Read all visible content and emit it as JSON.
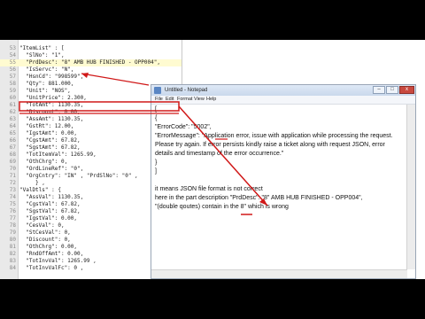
{
  "editor": {
    "lines": [
      {
        "n": "53",
        "text": "\"ItemList\" : ["
      },
      {
        "n": "54",
        "text": "  \"SlNo\": \"1\","
      },
      {
        "n": "55",
        "text": "  \"PrdDesc\": \"8\" AMB HUB FINISHED - OPP004\","
      },
      {
        "n": "56",
        "text": "  \"IsServc\": \"N\","
      },
      {
        "n": "57",
        "text": "  \"HsnCd\": \"998599\","
      },
      {
        "n": "58",
        "text": "  \"Qty\": 881.000,"
      },
      {
        "n": "59",
        "text": "  \"Unit\": \"NOS\","
      },
      {
        "n": "60",
        "text": "  \"UnitPrice\": 2.300,"
      },
      {
        "n": "61",
        "text": "  \"TotAmt\": 1130.35,"
      },
      {
        "n": "62",
        "text": "  \"Discount\": 0.00,"
      },
      {
        "n": "63",
        "text": "  \"AssAmt\": 1130.35,"
      },
      {
        "n": "64",
        "text": "  \"GstRt\": 12.00,"
      },
      {
        "n": "65",
        "text": "  \"IgstAmt\": 0.00,"
      },
      {
        "n": "66",
        "text": "  \"CgstAmt\": 67.82,"
      },
      {
        "n": "67",
        "text": "  \"SgstAmt\": 67.82,"
      },
      {
        "n": "68",
        "text": "  \"TotItemVal\": 1265.99,"
      },
      {
        "n": "69",
        "text": "  \"OthChrg\": 0,"
      },
      {
        "n": "70",
        "text": "  \"OrdLineRef\": \"0\","
      },
      {
        "n": "71",
        "text": "  \"OrgCntry\": \"IN\" , \"PrdSlNo\": \"0\" ,"
      },
      {
        "n": "72",
        "text": "     } ,"
      },
      {
        "n": "73",
        "text": "\"ValDtls\" : {"
      },
      {
        "n": "74",
        "text": "  \"AssVal\": 1130.35,"
      },
      {
        "n": "75",
        "text": "  \"CgstVal\": 67.82,"
      },
      {
        "n": "76",
        "text": "  \"SgstVal\": 67.82,"
      },
      {
        "n": "77",
        "text": "  \"IgstVal\": 0.00,"
      },
      {
        "n": "78",
        "text": "  \"CesVal\": 0,"
      },
      {
        "n": "79",
        "text": "  \"StCesVal\": 0,"
      },
      {
        "n": "80",
        "text": "  \"Discount\": 0,"
      },
      {
        "n": "81",
        "text": "  \"OthChrg\": 0.00,"
      },
      {
        "n": "82",
        "text": "  \"RndOffAmt\": 0.00,"
      },
      {
        "n": "83",
        "text": "  \"TotInvVal\": 1265.99 ,"
      },
      {
        "n": "84",
        "text": "  \"TotInvValFc\": 0 ,"
      }
    ]
  },
  "notepad": {
    "title": "Untitled - Notepad",
    "menu": [
      "File",
      "Edit",
      "Format",
      "View",
      "Help"
    ],
    "buttons": {
      "minimize": "–",
      "maximize": "□",
      "close": "x"
    },
    "lines": [
      "[",
      "{",
      "\"ErrorCode\": \"5002\",",
      "\"ErrorMessage\": \"Application error, issue with application while processing the request.",
      "Please try again. If error persists kindly raise a ticket along with request JSON, error",
      "details and timestamp of the error occurrence.\"",
      "}",
      "]",
      "it means JSON file format is not correct",
      "here in the part description \"PrdDesc\": \"8\" AMB HUB FINISHED - OPP004\",",
      "\"(double qoutes) contain in the 8\" which is wrong"
    ]
  },
  "annotation": {
    "color": "#d01818"
  }
}
